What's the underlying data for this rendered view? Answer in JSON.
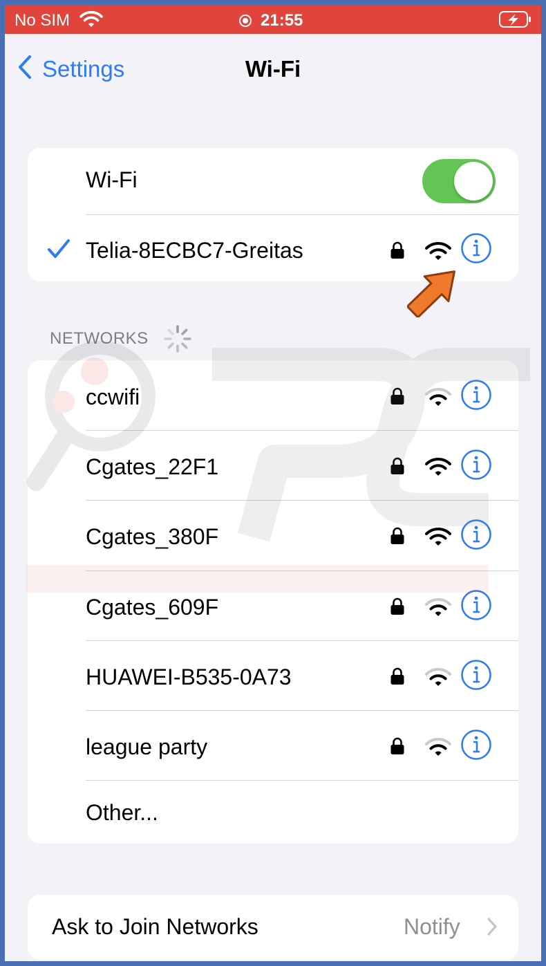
{
  "status_bar": {
    "carrier": "No SIM",
    "time": "21:55",
    "icons": [
      "wifi-icon",
      "location-icon",
      "battery-charging-icon"
    ]
  },
  "nav": {
    "back_label": "Settings",
    "title": "Wi-Fi"
  },
  "wifi_toggle": {
    "label": "Wi-Fi",
    "on": true
  },
  "connected": {
    "name": "Telia-8ECBC7-Greitas",
    "secured": true,
    "signal": "strong"
  },
  "networks_header": "NETWORKS",
  "networks": [
    {
      "name": "ccwifi",
      "secured": true,
      "signal": "weak"
    },
    {
      "name": "Cgates_22F1",
      "secured": true,
      "signal": "strong"
    },
    {
      "name": "Cgates_380F",
      "secured": true,
      "signal": "strong"
    },
    {
      "name": "Cgates_609F",
      "secured": true,
      "signal": "weak"
    },
    {
      "name": "HUAWEI-B535-0A73",
      "secured": true,
      "signal": "weak"
    },
    {
      "name": "league party",
      "secured": true,
      "signal": "weak"
    }
  ],
  "other_label": "Other...",
  "ask_to_join": {
    "label": "Ask to Join Networks",
    "value": "Notify"
  },
  "colors": {
    "status_bar": "#e0443a",
    "accent": "#2f7bf6",
    "toggle_on": "#62c554",
    "annotation_arrow": "#f07a2b"
  }
}
